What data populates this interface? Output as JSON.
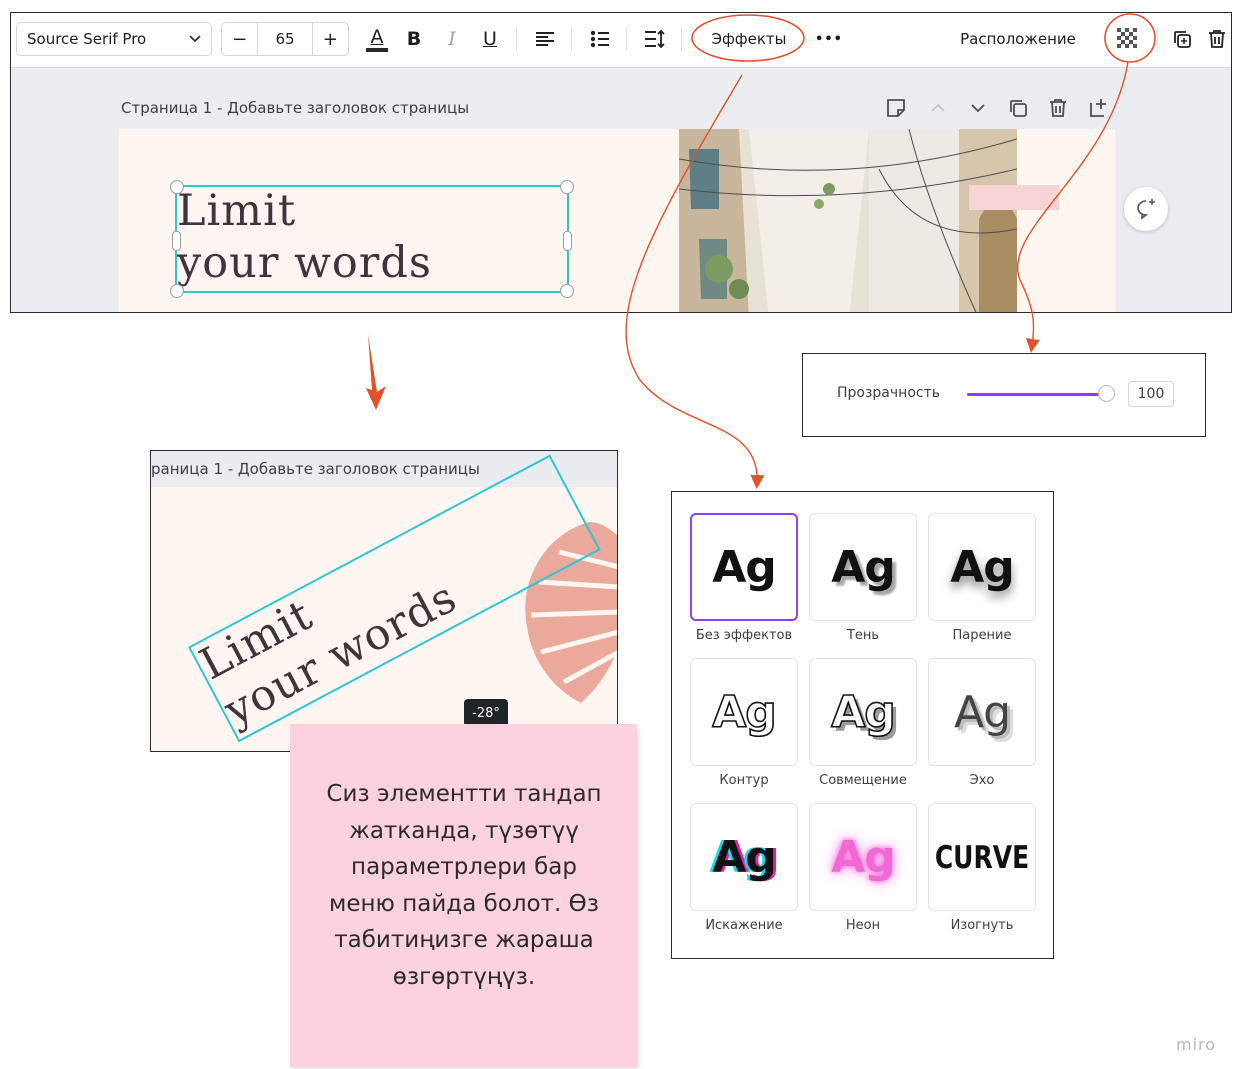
{
  "toolbar": {
    "font_family": "Source Serif Pro",
    "font_size": "65",
    "decrease_label": "−",
    "increase_label": "+",
    "text_color_glyph": "A",
    "bold_glyph": "B",
    "italic_glyph": "I",
    "underline_glyph": "U",
    "effects_label": "Эффекты",
    "more_glyph": "•••",
    "arrange_label": "Расположение"
  },
  "page": {
    "header": "Страница 1 - Добавьте заголовок страницы",
    "text_line1": "Limit",
    "text_line2": "your words"
  },
  "rotated_example": {
    "header": "раница 1 - Добавьте заголовок страницы",
    "text_line1": "Limit",
    "text_line2": "your words",
    "angle": "-28°",
    "angle_deg": -28
  },
  "transparency": {
    "label": "Прозрачность",
    "value": "100",
    "level": 1.0
  },
  "effects": [
    {
      "label": "Без эффектов",
      "sample": "Ag",
      "style": "none",
      "selected": true
    },
    {
      "label": "Тень",
      "sample": "Ag",
      "style": "shadow",
      "selected": false
    },
    {
      "label": "Парение",
      "sample": "Ag",
      "style": "lift",
      "selected": false
    },
    {
      "label": "Контур",
      "sample": "Ag",
      "style": "hollow",
      "selected": false
    },
    {
      "label": "Совмещение",
      "sample": "Ag",
      "style": "splice",
      "selected": false
    },
    {
      "label": "Эхо",
      "sample": "Ag",
      "style": "echo",
      "selected": false
    },
    {
      "label": "Искажение",
      "sample": "Ag",
      "style": "glitch",
      "selected": false
    },
    {
      "label": "Неон",
      "sample": "Ag",
      "style": "neon",
      "selected": false
    },
    {
      "label": "Изогнуть",
      "sample": "CURVE",
      "style": "curve",
      "selected": false
    }
  ],
  "note": {
    "text": "Сиз элементти тандап\nжатканда, түзөтүү\nпараметрлери бар\nменю пайда болот. Өз\nтабитиңизге жараша\nөзгөртүңүз."
  },
  "watermark": "miro",
  "colors": {
    "accent_purple": "#8b3dff",
    "selection_cyan": "#31c4d3",
    "annotation_red": "#e0512c",
    "sticky_pink": "#fcd2e1"
  }
}
